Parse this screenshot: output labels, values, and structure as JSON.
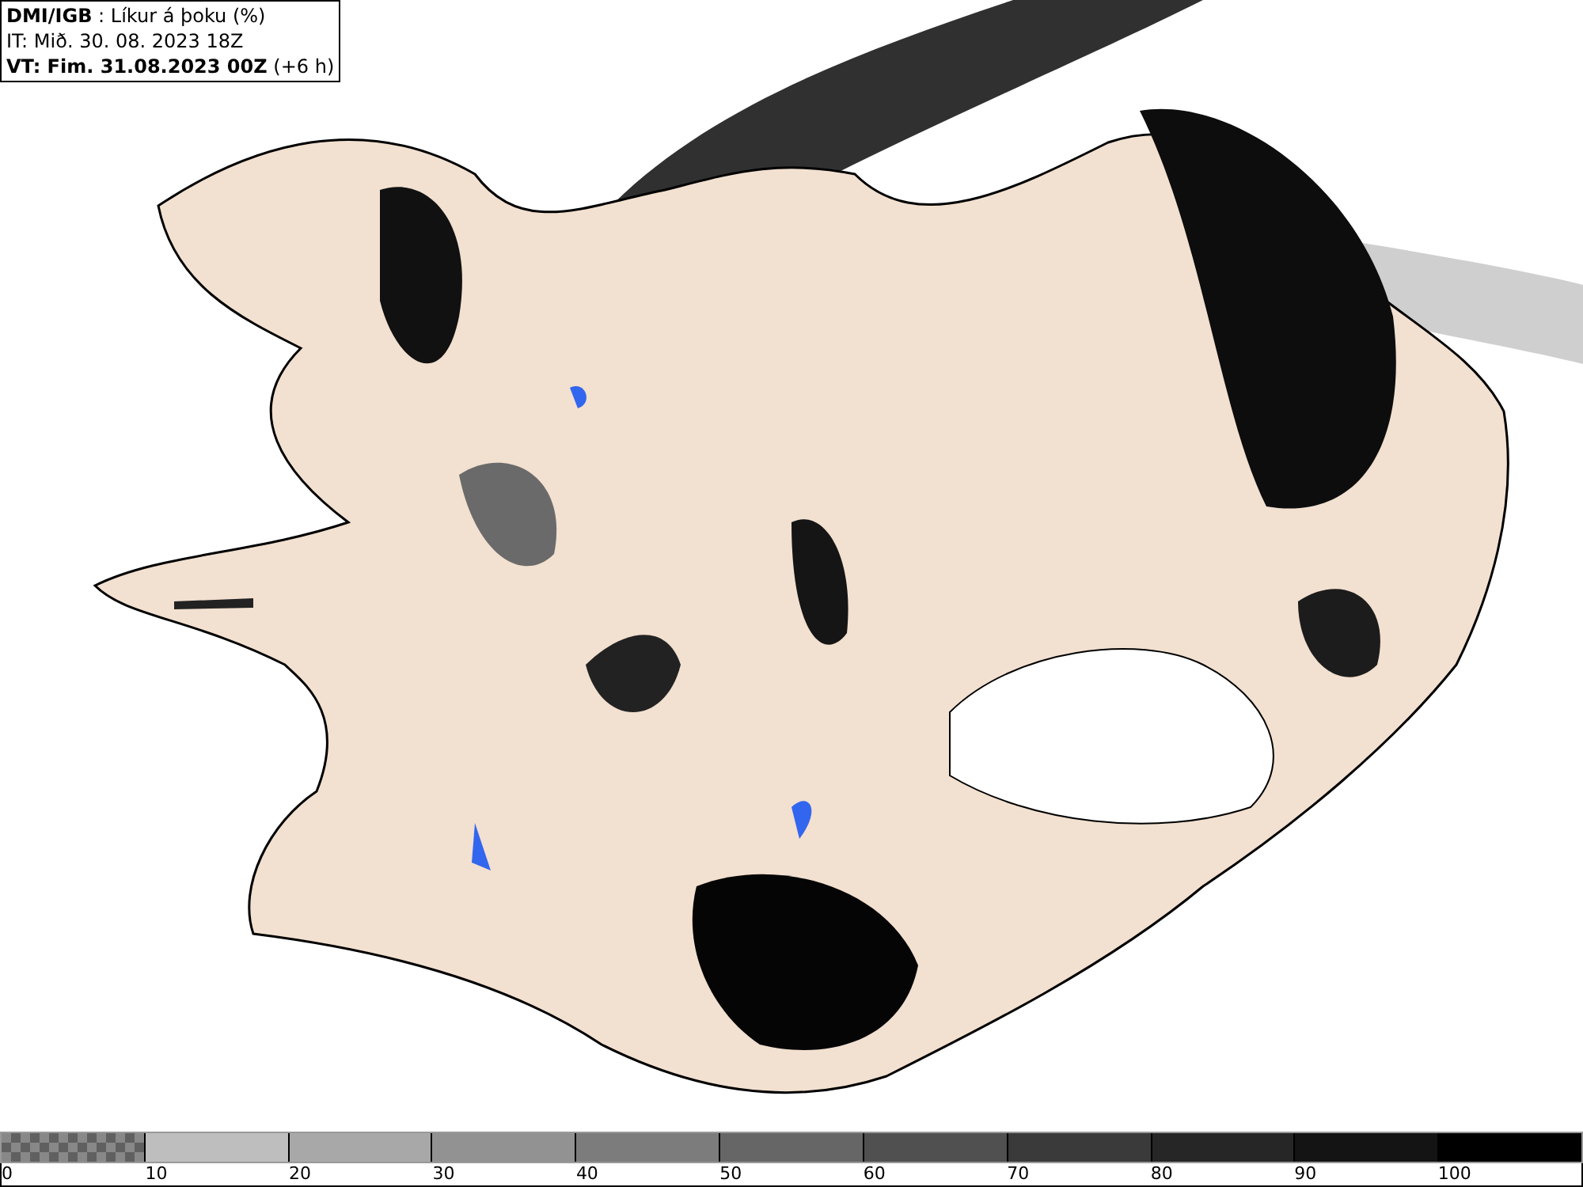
{
  "header": {
    "lines": [
      "**DMI/IGB** : Líkur á þoku (%)",
      "IT: Mið. 30. 08. 2023 18Z",
      "**VT: Fim. 31.08.2023 00Z** (+6 h)"
    ]
  },
  "legend": {
    "bins": [
      {
        "kind": "checker",
        "color": "#606060"
      },
      {
        "kind": "solid",
        "color": "#bebebe"
      },
      {
        "kind": "solid",
        "color": "#a8a8a8"
      },
      {
        "kind": "solid",
        "color": "#929292"
      },
      {
        "kind": "solid",
        "color": "#7c7c7c"
      },
      {
        "kind": "solid",
        "color": "#666666"
      },
      {
        "kind": "solid",
        "color": "#505050"
      },
      {
        "kind": "solid",
        "color": "#3a3a3a"
      },
      {
        "kind": "solid",
        "color": "#262626"
      },
      {
        "kind": "solid",
        "color": "#141414"
      },
      {
        "kind": "solid",
        "color": "#000000"
      }
    ],
    "labels": [
      "0",
      "10",
      "20",
      "30",
      "40",
      "50",
      "60",
      "70",
      "80",
      "90",
      "100"
    ]
  }
}
